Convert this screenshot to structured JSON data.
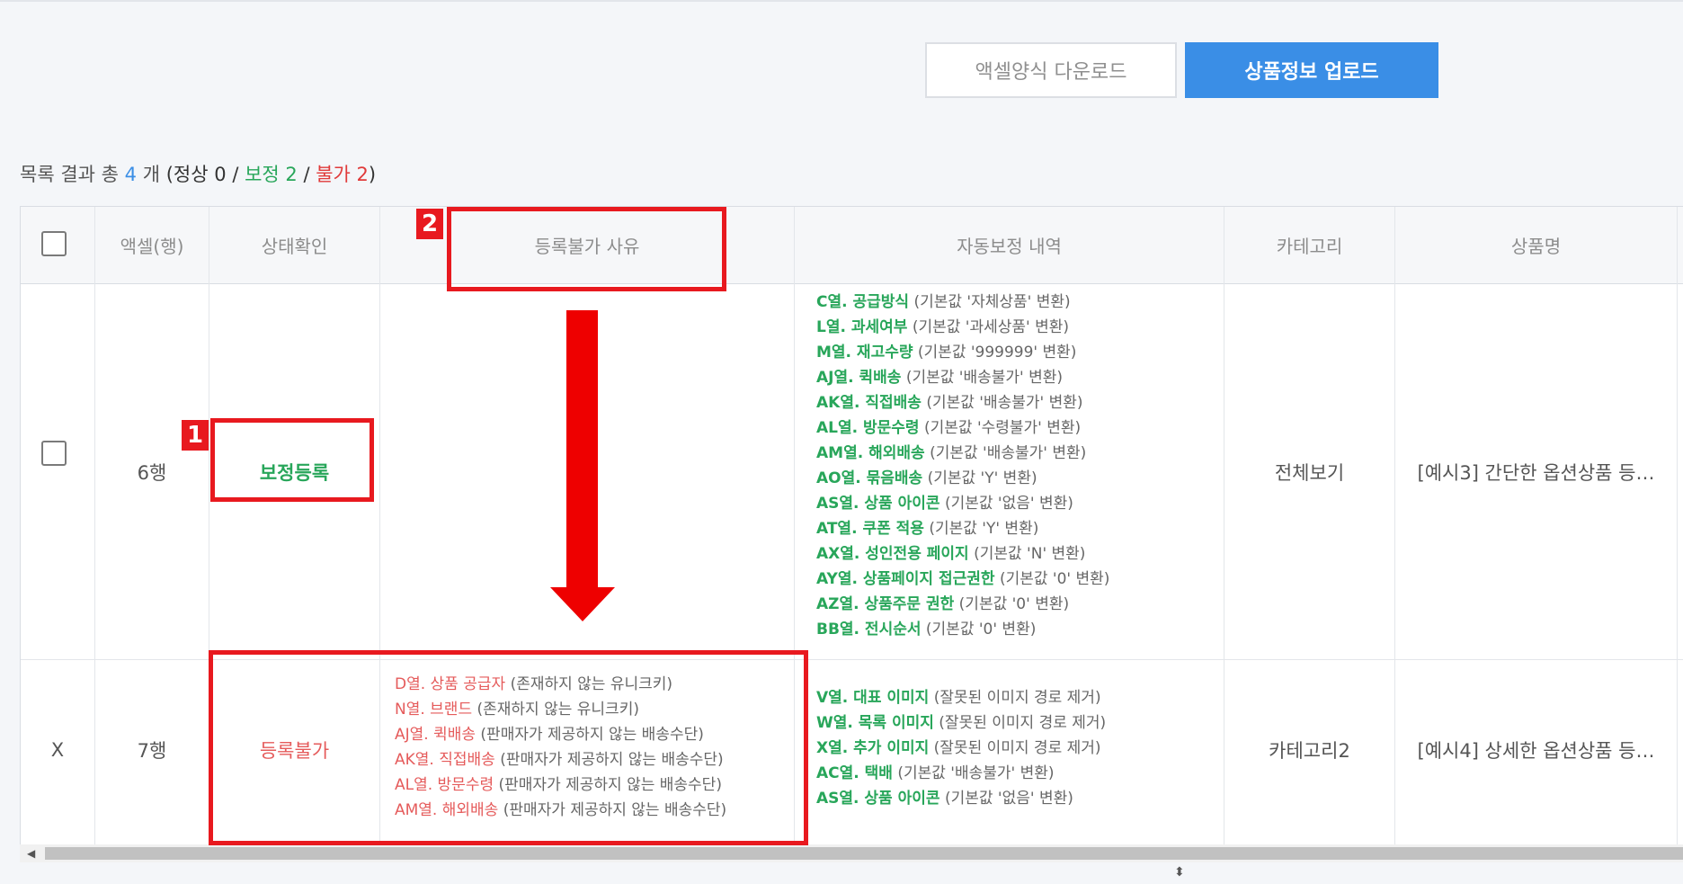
{
  "toolbar": {
    "excel_download_label": "액셀양식 다운로드",
    "upload_label": "상품정보 업로드"
  },
  "summary": {
    "prefix": "목록 결과 총",
    "total": "4",
    "unit": "개",
    "open": "(정상",
    "normal": "0",
    "sep1": "/",
    "corrected": "보정 2",
    "sep2": "/",
    "rejected": "불가 2",
    "close": ")"
  },
  "table": {
    "headers": {
      "excel_row": "액셀(행)",
      "status": "상태확인",
      "reject_reason": "등록불가 사유",
      "auto_fix": "자동보정 내역",
      "category": "카테고리",
      "product_name": "상품명"
    },
    "rows": [
      {
        "marker": "",
        "excel_row": "6행",
        "status": "보정등록",
        "category": "전체보기",
        "product_name": "[예시3] 간단한 옵션상품 등…",
        "reasons": [],
        "fixes": [
          {
            "col": "C열. 공급방식",
            "desc": "(기본값 '자체상품' 변환)"
          },
          {
            "col": "L열. 과세여부",
            "desc": "(기본값 '과세상품' 변환)"
          },
          {
            "col": "M열. 재고수량",
            "desc": "(기본값 '999999' 변환)"
          },
          {
            "col": "AJ열. 퀵배송",
            "desc": "(기본값 '배송불가' 변환)"
          },
          {
            "col": "AK열. 직접배송",
            "desc": "(기본값 '배송불가' 변환)"
          },
          {
            "col": "AL열. 방문수령",
            "desc": "(기본값 '수령불가' 변환)"
          },
          {
            "col": "AM열. 해외배송",
            "desc": "(기본값 '배송불가' 변환)"
          },
          {
            "col": "AO열. 묶음배송",
            "desc": "(기본값 'Y' 변환)"
          },
          {
            "col": "AS열. 상품 아이콘",
            "desc": "(기본값 '없음' 변환)"
          },
          {
            "col": "AT열. 쿠폰 적용",
            "desc": "(기본값 'Y' 변환)"
          },
          {
            "col": "AX열. 성인전용 페이지",
            "desc": "(기본값 'N' 변환)"
          },
          {
            "col": "AY열. 상품페이지 접근권한",
            "desc": "(기본값 '0' 변환)"
          },
          {
            "col": "AZ열. 상품주문 권한",
            "desc": "(기본값 '0' 변환)"
          },
          {
            "col": "BB열. 전시순서",
            "desc": "(기본값 '0' 변환)"
          }
        ]
      },
      {
        "marker": "X",
        "excel_row": "7행",
        "status": "등록불가",
        "category": "카테고리2",
        "product_name": "[예시4] 상세한 옵션상품 등…",
        "reasons": [
          {
            "col": "D열. 상품 공급자",
            "desc": "(존재하지 않는 유니크키)"
          },
          {
            "col": "N열. 브랜드",
            "desc": "(존재하지 않는 유니크키)"
          },
          {
            "col": "AJ열. 퀵배송",
            "desc": "(판매자가 제공하지 않는 배송수단)"
          },
          {
            "col": "AK열. 직접배송",
            "desc": "(판매자가 제공하지 않는 배송수단)"
          },
          {
            "col": "AL열. 방문수령",
            "desc": "(판매자가 제공하지 않는 배송수단)"
          },
          {
            "col": "AM열. 해외배송",
            "desc": "(판매자가 제공하지 않는 배송수단)"
          }
        ],
        "fixes": [
          {
            "col": "V열. 대표 이미지",
            "desc": "(잘못된 이미지 경로 제거)"
          },
          {
            "col": "W열. 목록 이미지",
            "desc": "(잘못된 이미지 경로 제거)"
          },
          {
            "col": "X열. 추가 이미지",
            "desc": "(잘못된 이미지 경로 제거)"
          },
          {
            "col": "AC열. 택배",
            "desc": "(기본값 '배송불가' 변환)"
          },
          {
            "col": "AS열. 상품 아이콘",
            "desc": "(기본값 '없음' 변환)"
          }
        ]
      }
    ]
  },
  "annotations": {
    "badge1": "1",
    "badge2": "2"
  },
  "colors": {
    "accent": "#3a8ee6",
    "corrected": "#28a65a",
    "rejected": "#e55b5b",
    "annotation": "#e8191f"
  }
}
